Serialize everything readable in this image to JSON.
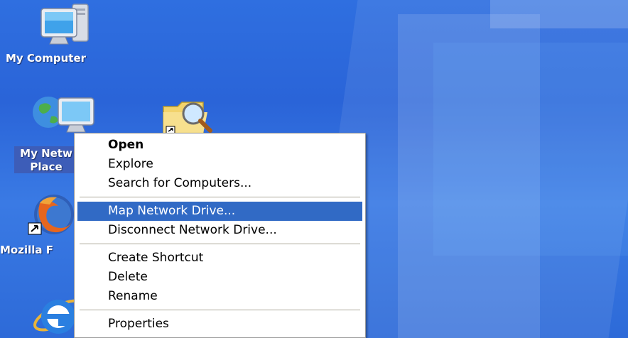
{
  "desktop": {
    "icons": [
      {
        "label": "My Computer",
        "icon": "my-computer-icon"
      },
      {
        "label_line1": "My Netw",
        "label_line2": "Place",
        "icon": "network-places-icon"
      },
      {
        "label": "",
        "icon": "search-folder-icon"
      },
      {
        "label": "Mozilla F",
        "icon": "firefox-icon"
      },
      {
        "label": "",
        "icon": "internet-explorer-icon"
      }
    ]
  },
  "context_menu": {
    "items": [
      {
        "label": "Open",
        "bold": true
      },
      {
        "label": "Explore"
      },
      {
        "label": "Search for Computers..."
      },
      {
        "label": "Map Network Drive...",
        "highlighted": true
      },
      {
        "label": "Disconnect Network Drive..."
      },
      {
        "label": "Create Shortcut"
      },
      {
        "label": "Delete"
      },
      {
        "label": "Rename"
      },
      {
        "label": "Properties"
      }
    ],
    "highlight_color": "#316ac5"
  }
}
